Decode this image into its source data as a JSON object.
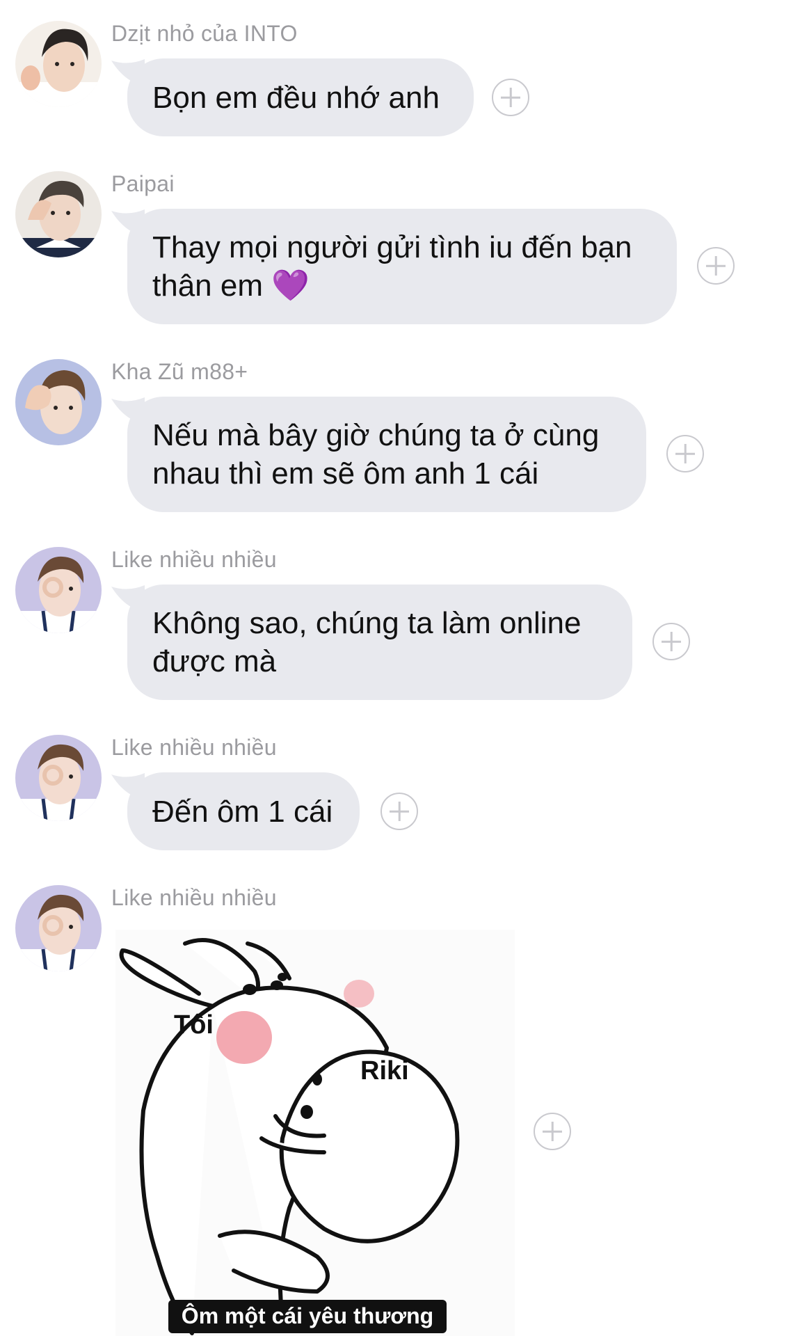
{
  "messages": [
    {
      "sender": "Dzịt nhỏ của INTO",
      "text": "Bọn em đều nhớ anh",
      "avatar": "avatar-ok-hand"
    },
    {
      "sender": "Paipai",
      "text": "Thay mọi người gửi tình iu đến bạn\nthân em 💜",
      "avatar": "avatar-eye-hand"
    },
    {
      "sender": "Kha Zũ m88+",
      "text": "Nếu mà bây giờ chúng ta ở cùng\nnhau thì em sẽ ôm anh 1 cái",
      "avatar": "avatar-eye-hand"
    },
    {
      "sender": "Like nhiều nhiều",
      "text": "Không sao, chúng ta làm online\nđược mà",
      "avatar": "avatar-ok-eye"
    },
    {
      "sender": "Like nhiều nhiều",
      "text": "Đến ôm 1 cái",
      "avatar": "avatar-ok-eye"
    },
    {
      "sender": "Like nhiều nhiều",
      "avatar": "avatar-ok-eye"
    }
  ],
  "sticker": {
    "label_left": "Tôi",
    "label_right": "Riki",
    "caption": "Ôm một cái yêu thương"
  },
  "icons": {
    "reaction": "add-reaction-icon"
  },
  "colors": {
    "bubble": "#e8e9ee",
    "sender": "#9b9b9f",
    "avatar_bg": "#c9c4e6"
  }
}
